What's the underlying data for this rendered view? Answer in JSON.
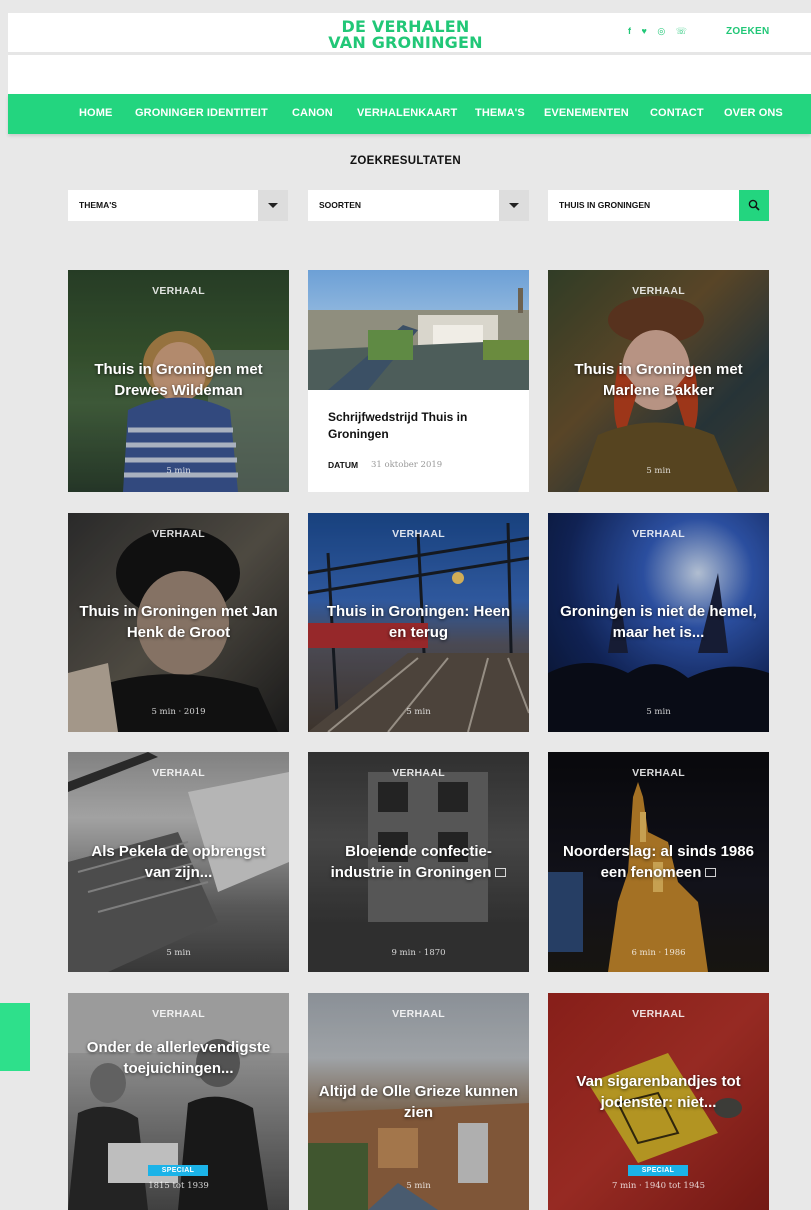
{
  "header": {
    "logo_line1": "DE VERHALEN",
    "logo_line2": "VAN GRONINGEN",
    "social": "f ♥ ◎ ☏",
    "search_label": "ZOEKEN"
  },
  "nav": {
    "items": [
      "HOME",
      "GRONINGER IDENTITEIT",
      "CANON",
      "VERHALENKAART",
      "THEMA'S",
      "EVENEMENTEN",
      "CONTACT",
      "OVER ONS"
    ]
  },
  "results": {
    "title": "ZOEKRESULTATEN"
  },
  "filters": {
    "themes": "THEMA'S",
    "types": "SOORTEN",
    "search_value": "THUIS IN GRONINGEN"
  },
  "cards": [
    {
      "type": "VERHAAL",
      "title": "Thuis in Groningen met Drewes Wildeman",
      "meta": "5 min"
    },
    {
      "title": "Schrijfwedstrijd Thuis in Groningen",
      "date_label": "DATUM",
      "date": "31 oktober 2019"
    },
    {
      "type": "VERHAAL",
      "title": "Thuis in Groningen met Marlene Bakker",
      "meta": "5 min"
    },
    {
      "type": "VERHAAL",
      "title": "Thuis in Groningen met Jan Henk de Groot",
      "meta": "5 min · 2019"
    },
    {
      "type": "VERHAAL",
      "title": "Thuis in Groningen: Heen en terug",
      "meta": "5 min"
    },
    {
      "type": "VERHAAL",
      "title": "Groningen is niet de hemel, maar het is...",
      "meta": "5 min"
    },
    {
      "type": "VERHAAL",
      "title": "Als Pekela de opbrengst van zijn...",
      "meta": "5 min"
    },
    {
      "type": "VERHAAL",
      "title": "Bloeiende confectie-industrie in Groningen",
      "meta": "9 min · 1870"
    },
    {
      "type": "VERHAAL",
      "title": "Noorderslag: al sinds 1986 een fenomeen",
      "meta": "6 min · 1986"
    },
    {
      "type": "VERHAAL",
      "title": "Onder de allerlevendigste toejuichingen...",
      "meta": "1815 tot 1939",
      "badge": "SPECIAL"
    },
    {
      "type": "VERHAAL",
      "title": "Altijd de Olle Grieze kunnen zien",
      "meta": "5 min"
    },
    {
      "type": "VERHAAL",
      "title": "Van sigarenbandjes tot jodenster: niet...",
      "meta": "7 min · 1940 tot 1945",
      "badge": "SPECIAL"
    }
  ],
  "colors": {
    "brand_green": "#23d57f",
    "special_badge": "#1bb3e8"
  }
}
